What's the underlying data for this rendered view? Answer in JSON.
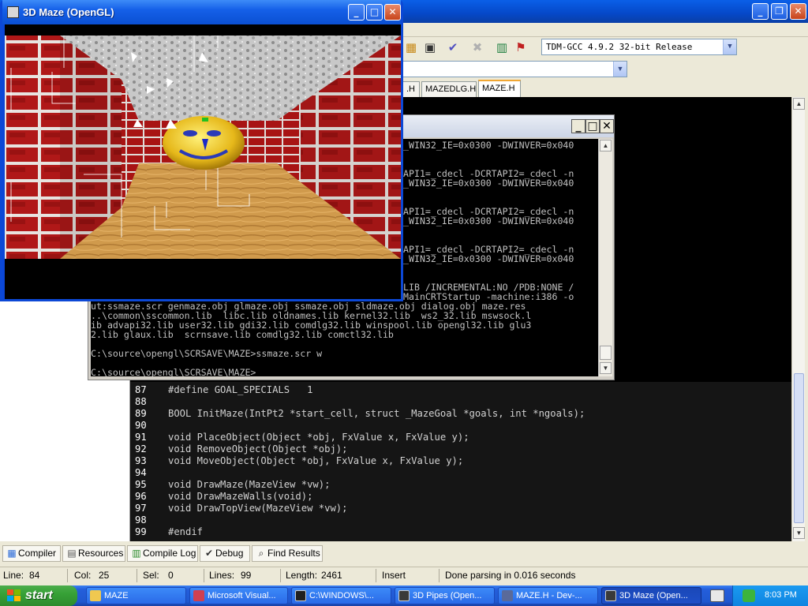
{
  "maze_window": {
    "title": "3D Maze (OpenGL)",
    "controls": {
      "minimize": "_",
      "maximize": "□",
      "close": "✕"
    }
  },
  "toolbar": {
    "compiler": "TDM-GCC 4.9.2 32-bit Release"
  },
  "editor_tabs": [
    {
      "label": ".H",
      "active": false
    },
    {
      "label": "MAZEDLG.H",
      "active": false
    },
    {
      "label": "MAZE.H",
      "active": true
    }
  ],
  "console": {
    "controls": {
      "minimize": "_",
      "maximize": "□",
      "close": "✕"
    },
    "lines": [
      "_WIN32_IE=0x0300 -DWINVER=0x040",
      "",
      "",
      "API1=_cdecl -DCRTAPI2=_cdecl -n",
      "_WIN32_IE=0x0300 -DWINVER=0x040",
      "",
      "",
      "API1=_cdecl -DCRTAPI2=_cdecl -n",
      "_WIN32_IE=0x0300 -DWINVER=0x040",
      "",
      "",
      "API1=_cdecl -DCRTAPI2=_cdecl -n",
      "_WIN32_IE=0x0300 -DWINVER=0x040",
      "",
      "",
      "LIB /INCREMENTAL:NO /PDB:NONE /",
      "MainCRTStartup -machine:i386 -o",
      "ut:ssmaze.scr genmaze.obj glmaze.obj ssmaze.obj sldmaze.obj dialog.obj maze.res",
      "..\\common\\sscommon.lib  libc.lib oldnames.lib kernel32.lib  ws2_32.lib mswsock.l",
      "ib advapi32.lib user32.lib gdi32.lib comdlg32.lib winspool.lib opengl32.lib glu3",
      "2.lib glaux.lib  scrnsave.lib comdlg32.lib comctl32.lib",
      "",
      "C:\\source\\opengl\\SCRSAVE\\MAZE>ssmaze.scr w",
      "",
      "C:\\source\\opengl\\SCRSAVE\\MAZE>"
    ]
  },
  "code_lines": [
    {
      "num": "87",
      "text": "#define GOAL_SPECIALS   1"
    },
    {
      "num": "88",
      "text": ""
    },
    {
      "num": "89",
      "text": "BOOL InitMaze(IntPt2 *start_cell, struct _MazeGoal *goals, int *ngoals);"
    },
    {
      "num": "90",
      "text": ""
    },
    {
      "num": "91",
      "text": "void PlaceObject(Object *obj, FxValue x, FxValue y);"
    },
    {
      "num": "92",
      "text": "void RemoveObject(Object *obj);"
    },
    {
      "num": "93",
      "text": "void MoveObject(Object *obj, FxValue x, FxValue y);"
    },
    {
      "num": "94",
      "text": ""
    },
    {
      "num": "95",
      "text": "void DrawMaze(MazeView *vw);"
    },
    {
      "num": "96",
      "text": "void DrawMazeWalls(void);"
    },
    {
      "num": "97",
      "text": "void DrawTopView(MazeView *vw);"
    },
    {
      "num": "98",
      "text": ""
    },
    {
      "num": "99",
      "text": "#endif"
    }
  ],
  "bottom_tabs": [
    {
      "label": "Compiler",
      "icon": "compiler-icon"
    },
    {
      "label": "Resources",
      "icon": "resources-icon"
    },
    {
      "label": "Compile Log",
      "icon": "compile-log-icon"
    },
    {
      "label": "Debug",
      "icon": "debug-icon"
    },
    {
      "label": "Find Results",
      "icon": "find-results-icon"
    }
  ],
  "status": {
    "line_label": "Line:",
    "line_value": "84",
    "col_label": "Col:",
    "col_value": "25",
    "sel_label": "Sel:",
    "sel_value": "0",
    "lines_label": "Lines:",
    "lines_value": "99",
    "length_label": "Length:",
    "length_value": "2461",
    "mode": "Insert",
    "message": "Done parsing in 0.016 seconds"
  },
  "taskbar": {
    "start": "start",
    "tasks": [
      {
        "label": "MAZE",
        "icon_color": "#f0c850",
        "active": false
      },
      {
        "label": "Microsoft Visual...",
        "icon_color": "#d04050",
        "active": false
      },
      {
        "label": "C:\\WINDOWS\\...",
        "icon_color": "#202020",
        "active": false
      },
      {
        "label": "3D Pipes (Open...",
        "icon_color": "#3a3a3a",
        "active": false
      },
      {
        "label": "MAZE.H - Dev-...",
        "icon_color": "#5a6a9a",
        "active": false
      },
      {
        "label": "3D Maze (Open...",
        "icon_color": "#3a3a3a",
        "active": true
      }
    ],
    "clock": "8:03 PM"
  }
}
